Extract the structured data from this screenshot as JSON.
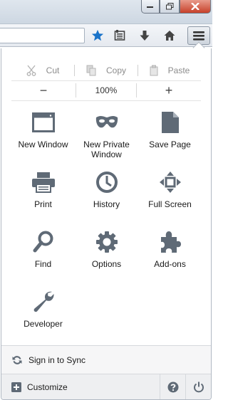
{
  "edit": {
    "cut": "Cut",
    "copy": "Copy",
    "paste": "Paste"
  },
  "zoom": {
    "out": "−",
    "level": "100%",
    "in": "+"
  },
  "items": [
    {
      "label": "New Window",
      "icon": "new-window-icon"
    },
    {
      "label": "New Private Window",
      "icon": "mask-icon"
    },
    {
      "label": "Save Page",
      "icon": "page-icon"
    },
    {
      "label": "Print",
      "icon": "printer-icon"
    },
    {
      "label": "History",
      "icon": "clock-icon"
    },
    {
      "label": "Full Screen",
      "icon": "fullscreen-icon"
    },
    {
      "label": "Find",
      "icon": "magnifier-icon"
    },
    {
      "label": "Options",
      "icon": "gear-icon"
    },
    {
      "label": "Add-ons",
      "icon": "puzzle-icon"
    },
    {
      "label": "Developer",
      "icon": "wrench-icon"
    }
  ],
  "footer": {
    "sync": "Sign in to Sync",
    "customize": "Customize"
  },
  "colors": {
    "icon": "#5f6a76",
    "bookmark_star": "#1a73c9",
    "close_button": "#c7412a"
  }
}
